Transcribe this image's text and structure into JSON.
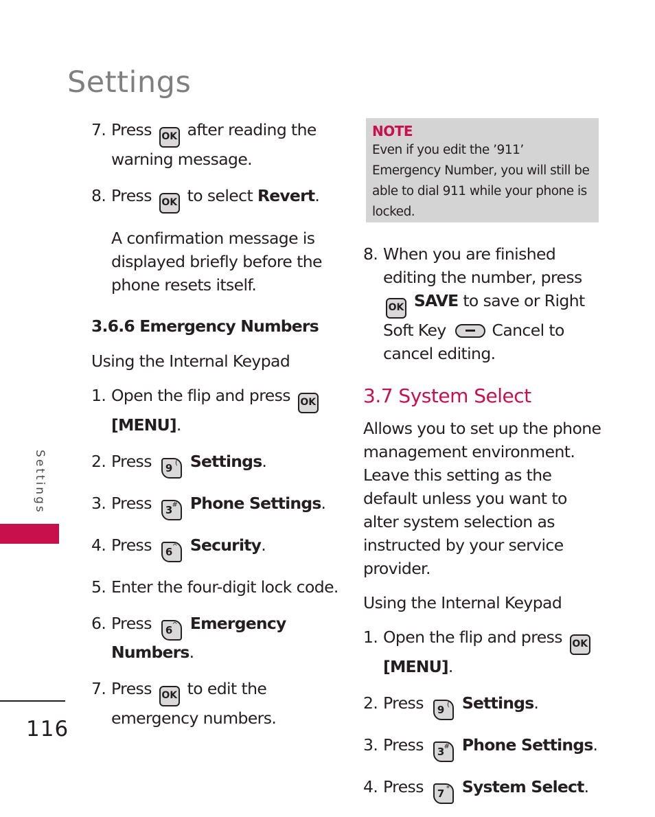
{
  "page": {
    "title": "Settings",
    "side_tab_label": "Settings",
    "page_number": "116",
    "accent_color": "#c8104d"
  },
  "left_column": {
    "step7a": {
      "num": "7.",
      "pre": "Press",
      "key": "OK",
      "post": "after reading the warning message."
    },
    "step8a": {
      "num": "8.",
      "pre": "Press",
      "key": "OK",
      "post": "to select",
      "bold": "Revert",
      "end": "."
    },
    "confirmation": "A confirmation message is displayed briefly before the phone resets itself.",
    "heading": "3.6.6 Emergency Numbers",
    "subheading": "Using the Internal Keypad",
    "step1": {
      "num": "1.",
      "pre": "Open the flip and press",
      "key": "OK",
      "bold": "[MENU]",
      "end": "."
    },
    "step2": {
      "num": "2.",
      "pre": "Press",
      "key_digit": "9",
      "key_sym": "(",
      "bold": "Settings",
      "end": "."
    },
    "step3": {
      "num": "3.",
      "pre": "Press",
      "key_digit": "3",
      "key_sym": "#",
      "bold": "Phone Settings",
      "end": "."
    },
    "step4": {
      "num": "4.",
      "pre": "Press",
      "key_digit": "6",
      "key_sym": "^",
      "bold": "Security",
      "end": "."
    },
    "step5": {
      "num": "5.",
      "text": "Enter the four-digit lock code."
    },
    "step6": {
      "num": "6.",
      "pre": "Press",
      "key_digit": "6",
      "key_sym": "^",
      "bold": "Emergency Numbers",
      "end": "."
    },
    "step7b": {
      "num": "7.",
      "pre": "Press",
      "key": "OK",
      "post": "to edit the emergency numbers."
    }
  },
  "note": {
    "label": "NOTE",
    "text": "Even if you edit the ’911’ Emergency Number, you will still be able to dial 911 while your phone is locked."
  },
  "right_column": {
    "step8b": {
      "num": "8.",
      "pre": "When you are finished editing the number, press",
      "key": "OK",
      "bold": "SAVE",
      "mid": "to save or Right Soft Key",
      "post": "Cancel to cancel editing."
    },
    "section_title": "3.7 System Select",
    "intro": "Allows you to set up the phone management environment. Leave this setting as the default unless you want to alter system selection as instructed by your service provider.",
    "subheading": "Using the Internal Keypad",
    "step1": {
      "num": "1.",
      "pre": "Open the flip and press",
      "key": "OK",
      "bold": "[MENU]",
      "end": "."
    },
    "step2": {
      "num": "2.",
      "pre": "Press",
      "key_digit": "9",
      "key_sym": "(",
      "bold": "Settings",
      "end": "."
    },
    "step3": {
      "num": "3.",
      "pre": "Press",
      "key_digit": "3",
      "key_sym": "#",
      "bold": "Phone Settings",
      "end": "."
    },
    "step4": {
      "num": "4.",
      "pre": "Press",
      "key_digit": "7",
      "key_sym": "*",
      "bold": "System Select",
      "end": "."
    }
  }
}
